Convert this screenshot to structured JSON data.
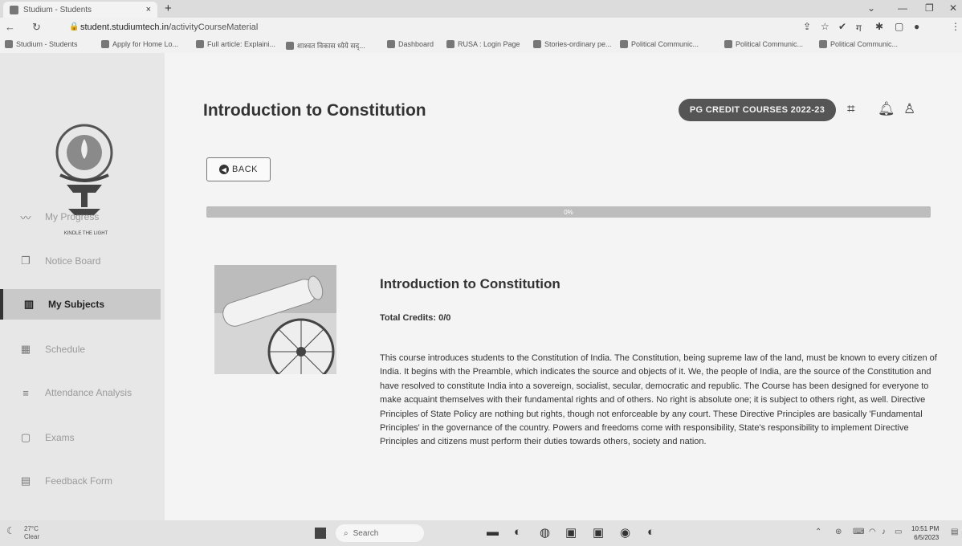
{
  "browser": {
    "tab_title": "Studium - Students",
    "tab_close": "×",
    "new_tab": "+",
    "url_host": "student.studiumtech.in",
    "url_path": "/activityCourseMaterial",
    "bookmarks": [
      "Studium - Students",
      "Apply for Home Lo...",
      "Full article: Explaini...",
      "शाश्वत विकास ध्येये सद्...",
      "Dashboard",
      "RUSA : Login Page",
      "Stories-ordinary pe...",
      "Political Communic...",
      "Political Communic...",
      "Political Communic..."
    ]
  },
  "sidebar": {
    "logo_caption": "KINDLE THE LIGHT",
    "items": [
      {
        "label": "My Progress",
        "icon": "progress-icon",
        "glyph": "〰"
      },
      {
        "label": "Notice Board",
        "icon": "notice-board-icon",
        "glyph": "❐"
      },
      {
        "label": "My Subjects",
        "icon": "book-icon",
        "glyph": "▥"
      },
      {
        "label": "Schedule",
        "icon": "calendar-icon",
        "glyph": "▦"
      },
      {
        "label": "Attendance Analysis",
        "icon": "attendance-icon",
        "glyph": "≡"
      },
      {
        "label": "Exams",
        "icon": "exams-icon",
        "glyph": "▢"
      },
      {
        "label": "Feedback Form",
        "icon": "feedback-icon",
        "glyph": "▤"
      }
    ],
    "active_index": 2
  },
  "header": {
    "title": "Introduction to Constitution",
    "badge": "PG CREDIT COURSES 2022-23"
  },
  "back_label": "BACK",
  "progress": {
    "value": 0,
    "label": "0%"
  },
  "course": {
    "title": "Introduction to Constitution",
    "credits": "Total Credits: 0/0",
    "description": "This course introduces students to the Constitution of India. The Constitution, being supreme law of the land, must be known to every citizen of India. It begins with the Preamble, which indicates the source and objects of it. We, the people of India, are the source of the Constitution and have resolved to constitute India into a sovereign, socialist, secular, democratic and republic. The Course has been designed for everyone to make acquaint themselves with their fundamental rights and of others. No right is absolute one; it is subject to others right, as well. Directive Principles of State Policy are nothing but rights, though not enforceable by any court. These Directive Principles are basically 'Fundamental Principles' in the governance of the country. Powers and freedoms come with responsibility, State's responsibility to implement Directive Principles and citizens must perform their duties towards others, society and nation."
  },
  "taskbar": {
    "temperature": "27°C",
    "weather": "Clear",
    "search": "Search",
    "time": "10:51 PM",
    "date": "6/5/2023"
  }
}
